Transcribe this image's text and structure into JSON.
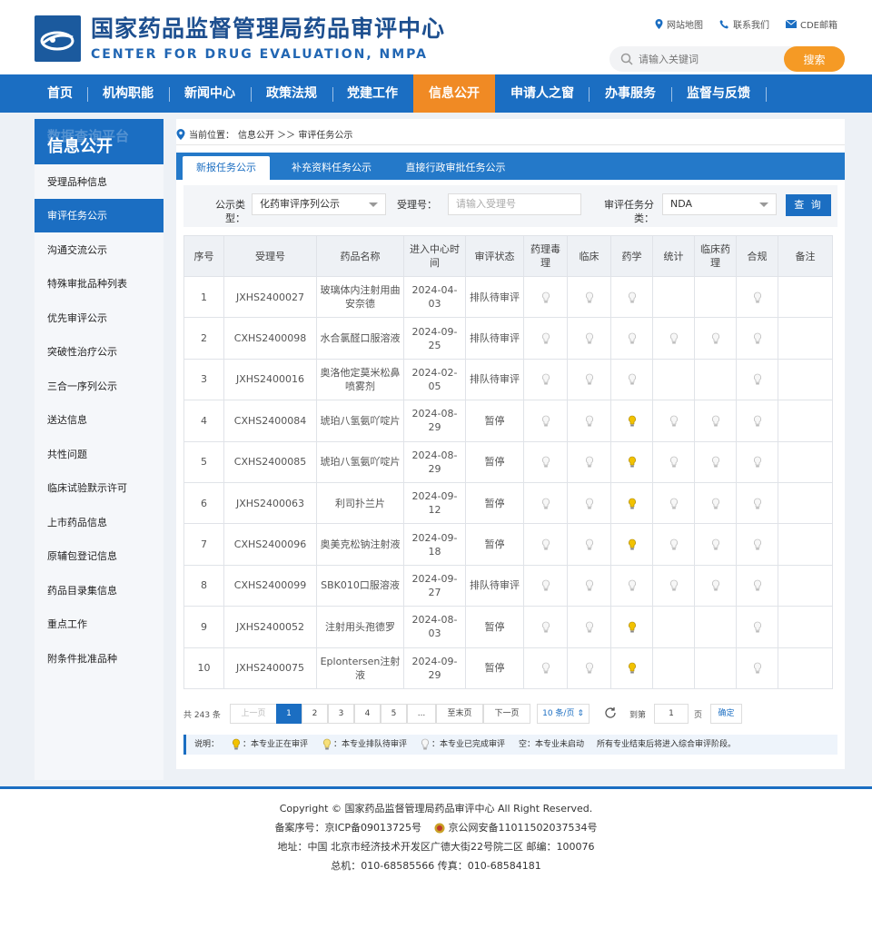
{
  "header": {
    "title_cn": "国家药品监督管理局药品审评中心",
    "title_en": "CENTER FOR DRUG EVALUATION, NMPA",
    "links": [
      "网站地图",
      "联系我们",
      "CDE邮箱"
    ],
    "search_placeholder": "请输入关键词",
    "search_button": "搜索"
  },
  "nav": {
    "items": [
      "首页",
      "机构职能",
      "新闻中心",
      "政策法规",
      "党建工作",
      "信息公开",
      "申请人之窗",
      "办事服务",
      "监督与反馈"
    ],
    "active": "信息公开"
  },
  "sidebar": {
    "ghost": "数据查询平台",
    "title": "信息公开",
    "items": [
      "受理品种信息",
      "审评任务公示",
      "沟通交流公示",
      "特殊审批品种列表",
      "优先审评公示",
      "突破性治疗公示",
      "三合一序列公示",
      "送达信息",
      "共性问题",
      "临床试验默示许可",
      "上市药品信息",
      "原辅包登记信息",
      "药品目录集信息",
      "重点工作",
      "附条件批准品种"
    ],
    "active": "审评任务公示"
  },
  "breadcrumb": {
    "label": "当前位置：",
    "path": "信息公开 ＞＞ 审评任务公示"
  },
  "tabs": [
    "新报任务公示",
    "补充资料任务公示",
    "直接行政审批任务公示"
  ],
  "filter": {
    "type_label": "公示类型：",
    "type_value": "化药审评序列公示",
    "accept_label": "受理号：",
    "accept_placeholder": "请输入受理号",
    "task_label": "审评任务分类：",
    "task_value": "NDA",
    "query_button": "查 询"
  },
  "table": {
    "headers": [
      "序号",
      "受理号",
      "药品名称",
      "进入中心时间",
      "审评状态",
      "药理毒理",
      "临床",
      "药学",
      "统计",
      "临床药理",
      "合规",
      "备注"
    ],
    "rows": [
      {
        "no": "1",
        "id": "JXHS2400027",
        "name": "玻璃体内注射用曲安奈德",
        "date": "2024-04-03",
        "status": "排队待审评",
        "cells": [
          "done",
          "done",
          "done",
          "",
          "",
          "done"
        ]
      },
      {
        "no": "2",
        "id": "CXHS2400098",
        "name": "水合氯醛口服溶液",
        "date": "2024-09-25",
        "status": "排队待审评",
        "cells": [
          "done",
          "done",
          "done",
          "done",
          "done",
          "done"
        ]
      },
      {
        "no": "3",
        "id": "JXHS2400016",
        "name": "奥洛他定莫米松鼻喷雾剂",
        "date": "2024-02-05",
        "status": "排队待审评",
        "cells": [
          "done",
          "done",
          "done",
          "",
          "",
          "done"
        ]
      },
      {
        "no": "4",
        "id": "CXHS2400084",
        "name": "琥珀八氢氨吖啶片",
        "date": "2024-08-29",
        "status": "暂停",
        "cells": [
          "done",
          "done",
          "active",
          "done",
          "done",
          "done"
        ]
      },
      {
        "no": "5",
        "id": "CXHS2400085",
        "name": "琥珀八氢氨吖啶片",
        "date": "2024-08-29",
        "status": "暂停",
        "cells": [
          "done",
          "done",
          "active",
          "done",
          "done",
          "done"
        ]
      },
      {
        "no": "6",
        "id": "JXHS2400063",
        "name": "利司扑兰片",
        "date": "2024-09-12",
        "status": "暂停",
        "cells": [
          "done",
          "done",
          "active",
          "done",
          "done",
          "done"
        ]
      },
      {
        "no": "7",
        "id": "CXHS2400096",
        "name": "奥美克松钠注射液",
        "date": "2024-09-18",
        "status": "暂停",
        "cells": [
          "done",
          "done",
          "active",
          "done",
          "done",
          "done"
        ]
      },
      {
        "no": "8",
        "id": "CXHS2400099",
        "name": "SBK010口服溶液",
        "date": "2024-09-27",
        "status": "排队待审评",
        "cells": [
          "done",
          "done",
          "done",
          "done",
          "done",
          "done"
        ]
      },
      {
        "no": "9",
        "id": "JXHS2400052",
        "name": "注射用头孢德罗",
        "date": "2024-08-03",
        "status": "暂停",
        "cells": [
          "done",
          "done",
          "active",
          "",
          "",
          "done"
        ]
      },
      {
        "no": "10",
        "id": "JXHS2400075",
        "name": "Eplontersen注射液",
        "date": "2024-09-29",
        "status": "暂停",
        "cells": [
          "done",
          "done",
          "active",
          "",
          "",
          "done"
        ]
      }
    ]
  },
  "pager": {
    "total": "共 243 条",
    "prev": "上一页",
    "pages": [
      "1",
      "2",
      "3",
      "4",
      "5",
      "..."
    ],
    "last": "至末页",
    "next": "下一页",
    "size": "10 条/页",
    "goto": "到第",
    "goto_value": "1",
    "page_unit": "页",
    "confirm": "确定"
  },
  "legend": {
    "label": "说明：",
    "active": "：本专业正在审评",
    "queued": "：本专业排队待审评",
    "done": "：本专业已完成审评",
    "empty": "空：本专业未启动",
    "note": "所有专业结束后将进入综合审评阶段。"
  },
  "footer": {
    "copyright": "Copyright © 国家药品监督管理局药品审评中心    All Right Reserved.",
    "icp": "备案序号：京ICP备09013725号",
    "police": "京公网安备11011502037534号",
    "address": "地址：中国 北京市经济技术开发区广德大街22号院二区      邮编：100076",
    "phone": "总机：010-68585566      传真：010-68584181"
  },
  "colors": {
    "primary": "#1b6ec2",
    "accent": "#f08a24",
    "bulb_active": "#f2c200"
  }
}
